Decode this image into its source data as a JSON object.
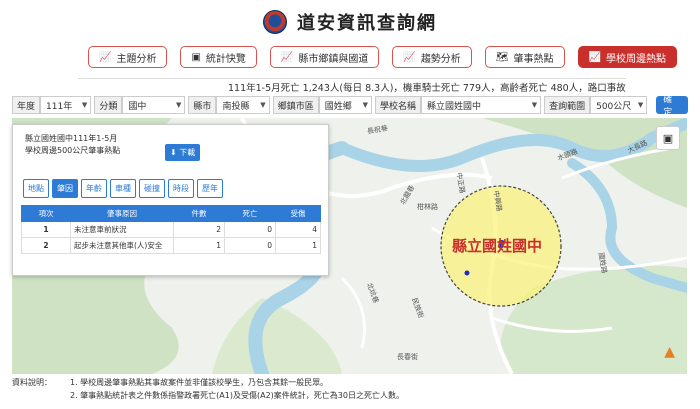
{
  "header": {
    "title": "道安資訊查詢網"
  },
  "tabs": [
    {
      "label": "主題分析",
      "icon": "chart-icon"
    },
    {
      "label": "統計快覽",
      "icon": "camera-icon"
    },
    {
      "label": "縣市鄉鎮與國道",
      "icon": "chart-icon"
    },
    {
      "label": "趨勢分析",
      "icon": "chart-icon"
    },
    {
      "label": "肇事熱點",
      "icon": "map-icon"
    },
    {
      "label": "學校周邊熱點",
      "icon": "chart-icon",
      "active": true
    }
  ],
  "marquee": {
    "text": "111年1-5月死亡 1,243人(每日 8.3人)，機車騎士死亡 779人，高齡者死亡 480人，路口事故死"
  },
  "filters": {
    "year_label": "年度",
    "year_value": "111年",
    "category_label": "分類",
    "category_value": "國中",
    "county_label": "縣市",
    "county_value": "南投縣",
    "town_label": "鄉鎮市區",
    "town_value": "國姓鄉",
    "school_label": "學校名稱",
    "school_value": "縣立國姓國中",
    "range_label": "查詢範圍",
    "range_value": "500公尺",
    "confirm_label": "確定"
  },
  "map": {
    "school_label": "縣立國姓國中",
    "road_labels": {
      "r1": "中興路",
      "r2": "北龍巷",
      "r3": "大長路",
      "r4": "國姓路",
      "r5": "民族街",
      "r6": "長春街",
      "r7": "北坑巷",
      "r8": "長祝巷",
      "r9": "水頭路",
      "r10": "柑林路",
      "r11": "中正路"
    },
    "colors": {
      "river": "#a9d3e6",
      "green": "#cfe3c4",
      "highlight": "#fbf27a",
      "accent": "#c9302c"
    }
  },
  "panel": {
    "title_line1": "縣立國姓國中111年1-5月",
    "title_line2": "學校周邊500公尺肇事熱點",
    "download_label": "下載",
    "subtabs": [
      "地點",
      "肇因",
      "年齡",
      "車種",
      "碰撞",
      "時段",
      "歷年"
    ],
    "active_subtab": 1,
    "table": {
      "headers": [
        "項次",
        "肇事原因",
        "件數",
        "死亡",
        "受傷"
      ],
      "rows": [
        {
          "no": "1",
          "cause": "未注意車前狀況",
          "count": "2",
          "death": "0",
          "injury": "4"
        },
        {
          "no": "2",
          "cause": "起步未注意其他車(人)安全",
          "count": "1",
          "death": "0",
          "injury": "1"
        }
      ]
    }
  },
  "notes": {
    "label": "資料說明：",
    "line1": "1. 學校周邊肇事熱點其事故案件並非僅該校學生，乃包含其餘一般民眾。",
    "line2": "2. 肇事熱點統計表之件數係指警政署死亡(A1)及受傷(A2)案件統計，死亡為30日之死亡人數。"
  }
}
